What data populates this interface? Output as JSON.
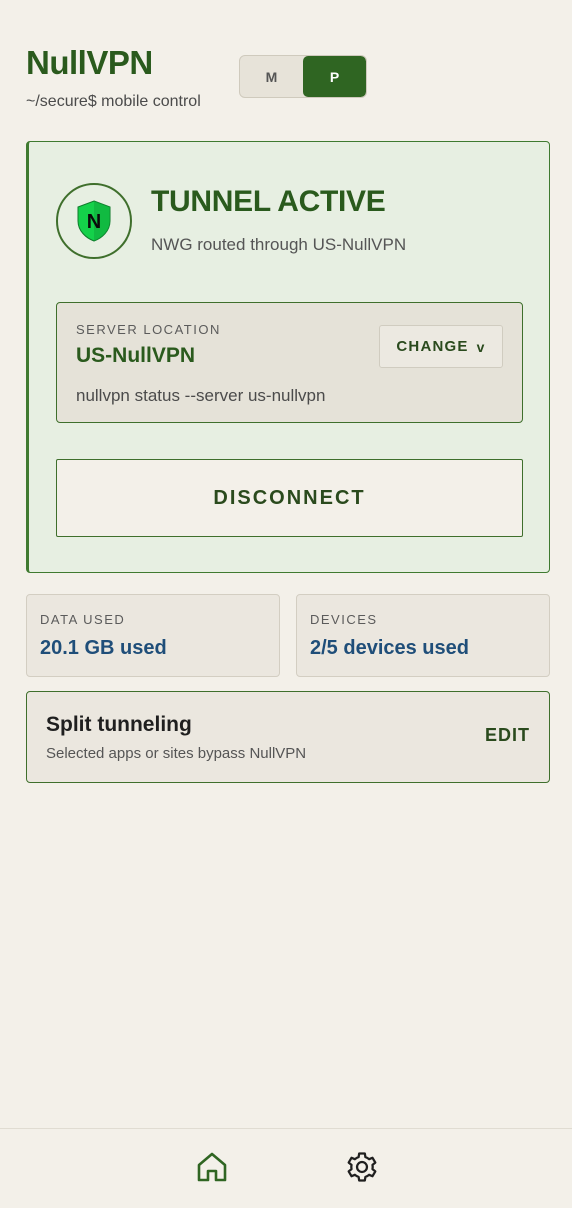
{
  "app": {
    "title": "NullVPN",
    "subtitle": "~/secure$ mobile control"
  },
  "mode_toggle": {
    "options": [
      {
        "label": "M",
        "active": false
      },
      {
        "label": "P",
        "active": true
      }
    ]
  },
  "tunnel": {
    "shield_letter": "N",
    "status_title": "TUNNEL ACTIVE",
    "status_subtitle": "NWG routed through US-NullVPN",
    "server": {
      "label": "SERVER LOCATION",
      "name": "US-NullVPN",
      "command": "nullvpn status --server us-nullvpn",
      "change_label": "CHANGE",
      "change_chevron": "v"
    },
    "disconnect_label": "DISCONNECT"
  },
  "stats": {
    "data_used": {
      "label": "DATA USED",
      "value": "20.1 GB used"
    },
    "devices": {
      "label": "DEVICES",
      "value": "2/5 devices used"
    }
  },
  "split_tunneling": {
    "title": "Split tunneling",
    "subtitle": "Selected apps or sites bypass NullVPN",
    "edit_label": "EDIT"
  },
  "bottom_nav": {
    "items": [
      {
        "icon": "home-icon",
        "active": true
      },
      {
        "icon": "gear-icon",
        "active": false
      }
    ]
  },
  "colors": {
    "brand_green": "#2a5a1d",
    "accent_green": "#2f6522",
    "value_blue": "#1f4e79",
    "background": "#f3f0e9"
  }
}
